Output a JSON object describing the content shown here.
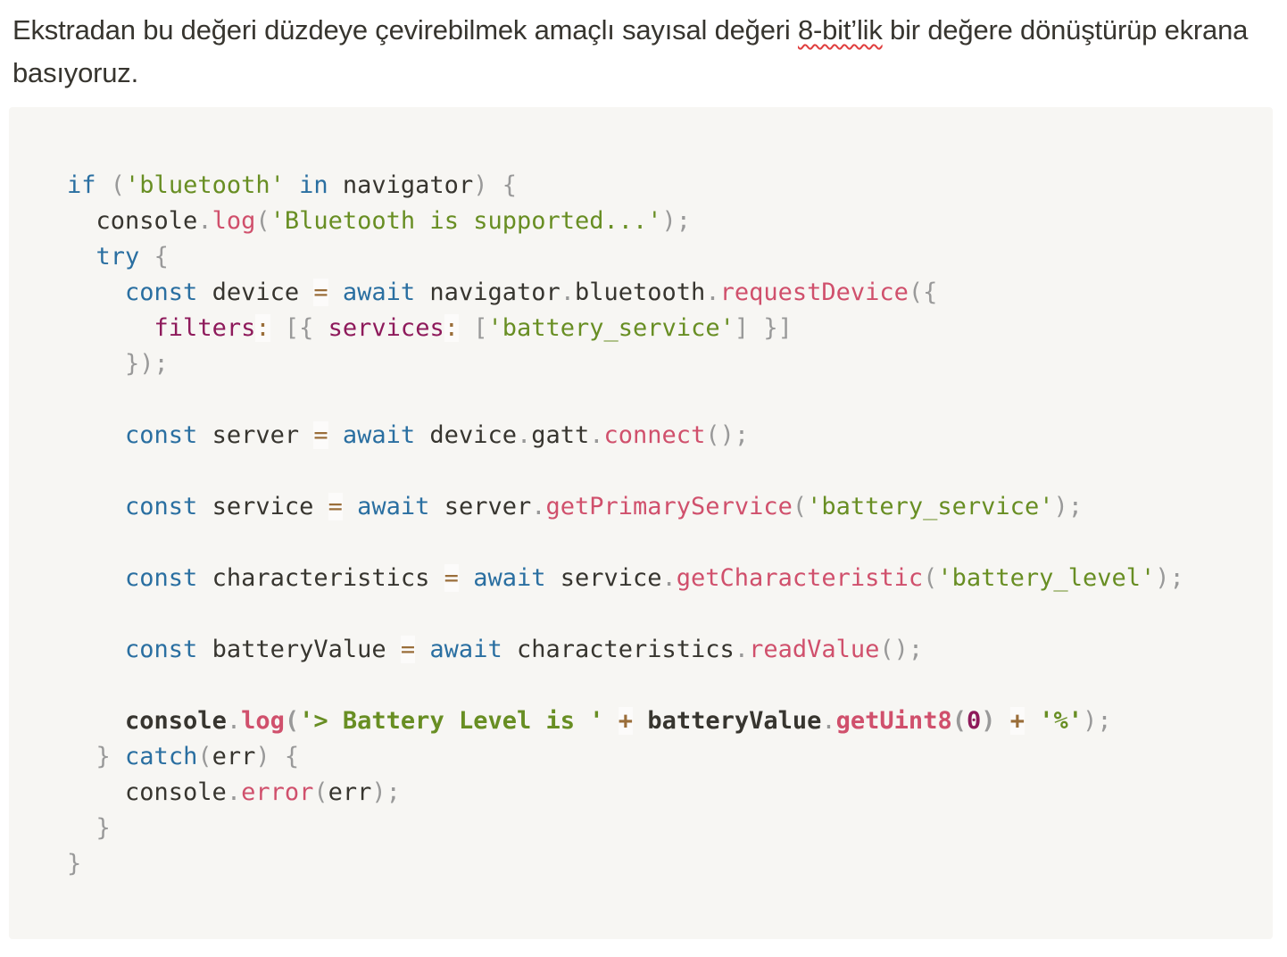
{
  "paragraph": {
    "text_before": "Ekstradan bu değeri düzdeye çevirebilmek amaçlı sayısal değeri ",
    "misspelled": "8-bit’lik",
    "text_after": " bir değere dönüştürüp ekrana basıyoruz."
  },
  "code": {
    "lines": [
      [
        {
          "t": "if",
          "c": "kw"
        },
        {
          "t": " "
        },
        {
          "t": "(",
          "c": "punc"
        },
        {
          "t": "'bluetooth'",
          "c": "str"
        },
        {
          "t": " "
        },
        {
          "t": "in",
          "c": "kw"
        },
        {
          "t": " navigator"
        },
        {
          "t": ")",
          "c": "punc"
        },
        {
          "t": " "
        },
        {
          "t": "{",
          "c": "punc"
        }
      ],
      [
        {
          "t": "  console"
        },
        {
          "t": ".",
          "c": "punc"
        },
        {
          "t": "log",
          "c": "fn"
        },
        {
          "t": "(",
          "c": "punc"
        },
        {
          "t": "'Bluetooth is supported...'",
          "c": "str"
        },
        {
          "t": ");",
          "c": "punc"
        }
      ],
      [
        {
          "t": "  "
        },
        {
          "t": "try",
          "c": "kw"
        },
        {
          "t": " "
        },
        {
          "t": "{",
          "c": "punc"
        }
      ],
      [
        {
          "t": "    "
        },
        {
          "t": "const",
          "c": "kw"
        },
        {
          "t": " device "
        },
        {
          "t": "=",
          "c": "op"
        },
        {
          "t": " "
        },
        {
          "t": "await",
          "c": "kw"
        },
        {
          "t": " navigator"
        },
        {
          "t": ".",
          "c": "punc"
        },
        {
          "t": "bluetooth"
        },
        {
          "t": ".",
          "c": "punc"
        },
        {
          "t": "requestDevice",
          "c": "fn"
        },
        {
          "t": "({",
          "c": "punc"
        }
      ],
      [
        {
          "t": "      "
        },
        {
          "t": "filters",
          "c": "prop"
        },
        {
          "t": ":",
          "c": "op"
        },
        {
          "t": " "
        },
        {
          "t": "[{",
          "c": "punc"
        },
        {
          "t": " "
        },
        {
          "t": "services",
          "c": "prop"
        },
        {
          "t": ":",
          "c": "op"
        },
        {
          "t": " "
        },
        {
          "t": "[",
          "c": "punc"
        },
        {
          "t": "'battery_service'",
          "c": "str"
        },
        {
          "t": "]",
          "c": "punc"
        },
        {
          "t": " "
        },
        {
          "t": "}]",
          "c": "punc"
        }
      ],
      [
        {
          "t": "    "
        },
        {
          "t": "});",
          "c": "punc"
        }
      ],
      [],
      [
        {
          "t": "    "
        },
        {
          "t": "const",
          "c": "kw"
        },
        {
          "t": " server "
        },
        {
          "t": "=",
          "c": "op"
        },
        {
          "t": " "
        },
        {
          "t": "await",
          "c": "kw"
        },
        {
          "t": " device"
        },
        {
          "t": ".",
          "c": "punc"
        },
        {
          "t": "gatt"
        },
        {
          "t": ".",
          "c": "punc"
        },
        {
          "t": "connect",
          "c": "fn"
        },
        {
          "t": "();",
          "c": "punc"
        }
      ],
      [],
      [
        {
          "t": "    "
        },
        {
          "t": "const",
          "c": "kw"
        },
        {
          "t": " service "
        },
        {
          "t": "=",
          "c": "op"
        },
        {
          "t": " "
        },
        {
          "t": "await",
          "c": "kw"
        },
        {
          "t": " server"
        },
        {
          "t": ".",
          "c": "punc"
        },
        {
          "t": "getPrimaryService",
          "c": "fn"
        },
        {
          "t": "(",
          "c": "punc"
        },
        {
          "t": "'battery_service'",
          "c": "str"
        },
        {
          "t": ");",
          "c": "punc"
        }
      ],
      [],
      [
        {
          "t": "    "
        },
        {
          "t": "const",
          "c": "kw"
        },
        {
          "t": " characteristics "
        },
        {
          "t": "=",
          "c": "op"
        },
        {
          "t": " "
        },
        {
          "t": "await",
          "c": "kw"
        },
        {
          "t": " service"
        },
        {
          "t": ".",
          "c": "punc"
        },
        {
          "t": "getCharacteristic",
          "c": "fn"
        },
        {
          "t": "(",
          "c": "punc"
        },
        {
          "t": "'battery_level'",
          "c": "str"
        },
        {
          "t": ");",
          "c": "punc"
        }
      ],
      [],
      [
        {
          "t": "    "
        },
        {
          "t": "const",
          "c": "kw"
        },
        {
          "t": " batteryValue "
        },
        {
          "t": "=",
          "c": "op"
        },
        {
          "t": " "
        },
        {
          "t": "await",
          "c": "kw"
        },
        {
          "t": " characteristics"
        },
        {
          "t": ".",
          "c": "punc"
        },
        {
          "t": "readValue",
          "c": "fn"
        },
        {
          "t": "();",
          "c": "punc"
        }
      ],
      [],
      [
        {
          "t": "    "
        },
        {
          "t": "console",
          "c": "bold"
        },
        {
          "t": ".",
          "c": "punc"
        },
        {
          "t": "log",
          "c": "fn bold"
        },
        {
          "t": "(",
          "c": "punc bold"
        },
        {
          "t": "'> Battery Level is '",
          "c": "str bold"
        },
        {
          "t": " "
        },
        {
          "t": "+",
          "c": "op bold"
        },
        {
          "t": " "
        },
        {
          "t": "batteryValue",
          "c": "bold"
        },
        {
          "t": ".",
          "c": "punc"
        },
        {
          "t": "getUint8",
          "c": "fn bold"
        },
        {
          "t": "(",
          "c": "punc bold"
        },
        {
          "t": "0",
          "c": "num bold"
        },
        {
          "t": ")",
          "c": "punc bold"
        },
        {
          "t": " "
        },
        {
          "t": "+",
          "c": "op bold"
        },
        {
          "t": " "
        },
        {
          "t": "'%'",
          "c": "str bold"
        },
        {
          "t": ");",
          "c": "punc"
        }
      ],
      [
        {
          "t": "  "
        },
        {
          "t": "}",
          "c": "punc"
        },
        {
          "t": " "
        },
        {
          "t": "catch",
          "c": "kw"
        },
        {
          "t": "(",
          "c": "punc"
        },
        {
          "t": "err"
        },
        {
          "t": ")",
          "c": "punc"
        },
        {
          "t": " "
        },
        {
          "t": "{",
          "c": "punc"
        }
      ],
      [
        {
          "t": "    console"
        },
        {
          "t": ".",
          "c": "punc"
        },
        {
          "t": "error",
          "c": "fn"
        },
        {
          "t": "(",
          "c": "punc"
        },
        {
          "t": "err"
        },
        {
          "t": ");",
          "c": "punc"
        }
      ],
      [
        {
          "t": "  "
        },
        {
          "t": "}",
          "c": "punc"
        }
      ],
      [
        {
          "t": "}",
          "c": "punc"
        }
      ]
    ]
  }
}
